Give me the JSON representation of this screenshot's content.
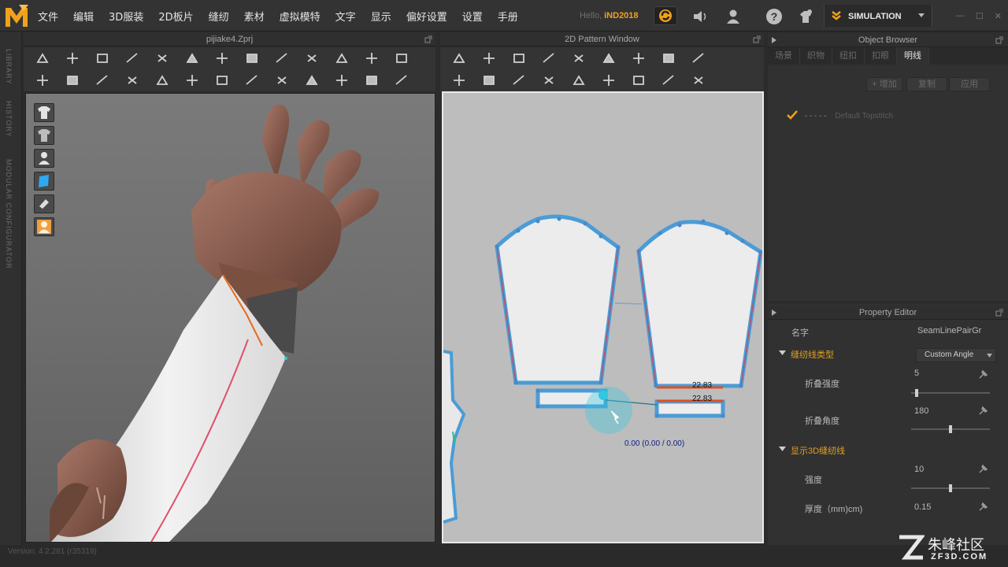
{
  "menubar": {
    "items": [
      "文件",
      "编辑",
      "3D服装",
      "2D板片",
      "缝纫",
      "素材",
      "虚拟模特",
      "文字",
      "显示",
      "偏好设置",
      "设置",
      "手册"
    ],
    "hello_label": "Hello,",
    "user": "iND2018",
    "mode": "SIMULATION"
  },
  "side_strip": [
    "LIBRARY",
    "HISTORY",
    "MODULAR CONFIGURATOR"
  ],
  "view3d": {
    "title": "pijiake4.Zprj"
  },
  "view2d": {
    "title": "2D Pattern Window",
    "measure_1": "22.83",
    "measure_2": "22.83",
    "coord_readout": "0.00 (0.00 / 0.00)"
  },
  "object_browser": {
    "title": "Object Browser",
    "tabs": [
      "场景",
      "织物",
      "纽扣",
      "扣眼",
      "明线"
    ],
    "active_tab": 4,
    "add_button": "+ 增加",
    "copy_button": "复制",
    "apply_button": "应用",
    "topstitch_dashes": "- - - - -",
    "topstitch_name": "Default Topstitch"
  },
  "property_editor": {
    "title": "Property Editor",
    "name_label": "名字",
    "name_value": "SeamLinePairGr",
    "section_1": "缝纫线类型",
    "fold_type": "Custom Angle",
    "fold_strength_label": "折叠强度",
    "fold_strength_value": "5",
    "fold_strength_fraction": 0.05,
    "fold_angle_label": "折叠角度",
    "fold_angle_value": "180",
    "fold_angle_fraction": 0.5,
    "section_2": "显示3D缝纫线",
    "strength_label": "强度",
    "strength_value": "10",
    "strength_fraction": 0.5,
    "thickness_label": "厚度（mm)cm)",
    "thickness_value": "0.15"
  },
  "status": {
    "version": "Version: 4.2.281 (r35319)"
  },
  "watermark": {
    "text_cn": "朱峰社区",
    "text_url": "ZF3D.COM"
  },
  "colors": {
    "accent": "#f0a21a",
    "seam": "#e05020",
    "pattern_outline": "#4a9cd6",
    "highlight": "#30c8e0"
  }
}
